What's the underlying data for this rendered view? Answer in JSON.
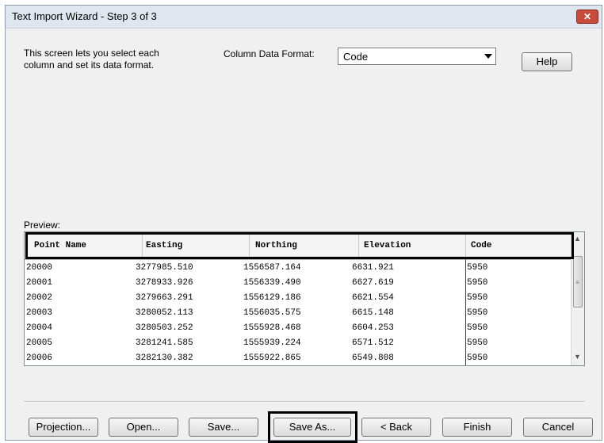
{
  "window": {
    "title": "Text Import Wizard - Step 3 of 3",
    "close_label": "✕"
  },
  "description": {
    "line1": "This screen lets you select each",
    "line2": "column and set its data format."
  },
  "column_format": {
    "label": "Column Data Format:",
    "selected": "Code"
  },
  "help_label": "Help",
  "preview": {
    "label": "Preview:",
    "headers": [
      "Point Name",
      "Easting",
      "Northing",
      "Elevation",
      "Code"
    ],
    "rows": [
      [
        "20000",
        "3277985.510",
        "1556587.164",
        "6631.921",
        "5950"
      ],
      [
        "20001",
        "3278933.926",
        "1556339.490",
        "6627.619",
        "5950"
      ],
      [
        "20002",
        "3279663.291",
        "1556129.186",
        "6621.554",
        "5950"
      ],
      [
        "20003",
        "3280052.113",
        "1556035.575",
        "6615.148",
        "5950"
      ],
      [
        "20004",
        "3280503.252",
        "1555928.468",
        "6604.253",
        "5950"
      ],
      [
        "20005",
        "3281241.585",
        "1555939.224",
        "6571.512",
        "5950"
      ],
      [
        "20006",
        "3282130.382",
        "1555922.865",
        "6549.808",
        "5950"
      ]
    ]
  },
  "buttons": {
    "projection": "Projection...",
    "open": "Open...",
    "save": "Save...",
    "save_as": "Save As...",
    "back": "< Back",
    "finish": "Finish",
    "cancel": "Cancel"
  }
}
